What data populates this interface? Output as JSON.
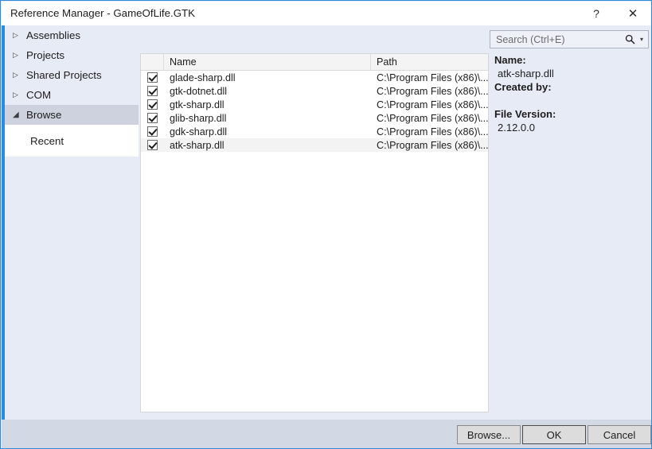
{
  "window": {
    "title": "Reference Manager - GameOfLife.GTK",
    "help_icon": "question-mark-icon",
    "close_icon": "close-x-icon",
    "help_glyph": "?",
    "close_glyph": "✕",
    "accent_color": "#2e8bd8"
  },
  "sidebar": {
    "items": [
      {
        "label": "Assemblies",
        "expanded": false,
        "selected": false
      },
      {
        "label": "Projects",
        "expanded": false,
        "selected": false
      },
      {
        "label": "Shared Projects",
        "expanded": false,
        "selected": false
      },
      {
        "label": "COM",
        "expanded": false,
        "selected": false
      },
      {
        "label": "Browse",
        "expanded": true,
        "selected": true
      }
    ],
    "browse_children": [
      {
        "label": "Recent"
      }
    ]
  },
  "search": {
    "placeholder": "Search (Ctrl+E)",
    "value": "",
    "icon": "magnifier-icon",
    "caret_glyph": "▾"
  },
  "list": {
    "columns": [
      "",
      "Name",
      "Path"
    ],
    "rows": [
      {
        "checked": true,
        "name": "glade-sharp.dll",
        "path": "C:\\Program Files (x86)\\...",
        "selected": false
      },
      {
        "checked": true,
        "name": "gtk-dotnet.dll",
        "path": "C:\\Program Files (x86)\\...",
        "selected": false
      },
      {
        "checked": true,
        "name": "gtk-sharp.dll",
        "path": "C:\\Program Files (x86)\\...",
        "selected": false
      },
      {
        "checked": true,
        "name": "glib-sharp.dll",
        "path": "C:\\Program Files (x86)\\...",
        "selected": false
      },
      {
        "checked": true,
        "name": "gdk-sharp.dll",
        "path": "C:\\Program Files (x86)\\...",
        "selected": false
      },
      {
        "checked": true,
        "name": "atk-sharp.dll",
        "path": "C:\\Program Files (x86)\\...",
        "selected": true
      }
    ]
  },
  "details": {
    "name_label": "Name:",
    "name_value": "atk-sharp.dll",
    "created_by_label": "Created by:",
    "created_by_value": "",
    "file_version_label": "File Version:",
    "file_version_value": "2.12.0.0"
  },
  "footer": {
    "browse_label": "Browse...",
    "ok_label": "OK",
    "cancel_label": "Cancel"
  }
}
